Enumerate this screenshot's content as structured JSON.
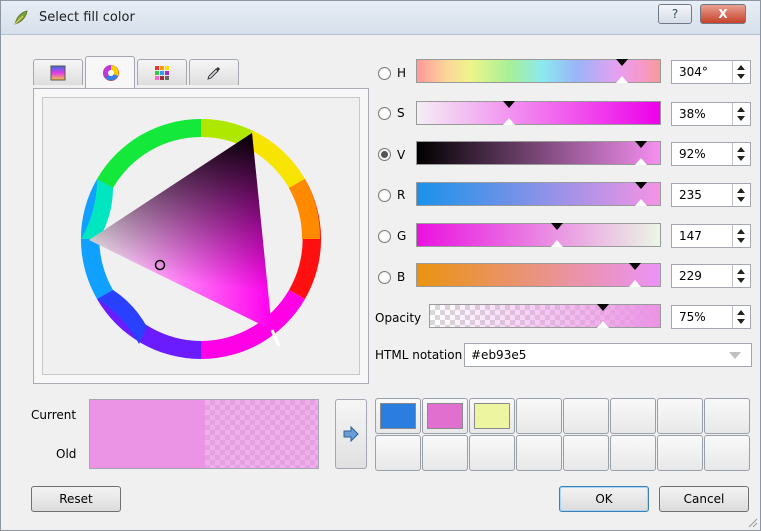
{
  "window": {
    "title": "Select fill color",
    "help_label": "?",
    "close_label": "X"
  },
  "tabs": [
    {
      "name": "color-ramp-tab",
      "active": false
    },
    {
      "name": "color-wheel-tab",
      "active": true
    },
    {
      "name": "color-swatches-tab",
      "active": false
    },
    {
      "name": "color-picker-tab",
      "active": false
    }
  ],
  "channels": {
    "h": {
      "label": "H",
      "value": "304°",
      "fraction": 0.845,
      "selected": false
    },
    "s": {
      "label": "S",
      "value": "38%",
      "fraction": 0.38,
      "selected": false
    },
    "v": {
      "label": "V",
      "value": "92%",
      "fraction": 0.92,
      "selected": true
    },
    "r": {
      "label": "R",
      "value": "235",
      "fraction": 0.92,
      "selected": false
    },
    "g": {
      "label": "G",
      "value": "147",
      "fraction": 0.576,
      "selected": false
    },
    "b": {
      "label": "B",
      "value": "229",
      "fraction": 0.897,
      "selected": false
    },
    "opacity": {
      "label": "Opacity",
      "value": "75%",
      "fraction": 0.75
    }
  },
  "html_notation": {
    "label": "HTML notation",
    "value": "#eb93e5"
  },
  "preview": {
    "current_label": "Current",
    "old_label": "Old",
    "color": "#eb93e5"
  },
  "swatches": [
    "#2b7de0",
    "#e06fd0",
    "#eef5a0",
    "",
    "",
    "",
    "",
    "",
    "",
    "",
    "",
    "",
    "",
    "",
    "",
    ""
  ],
  "buttons": {
    "reset": "Reset",
    "ok": "OK",
    "cancel": "Cancel"
  }
}
